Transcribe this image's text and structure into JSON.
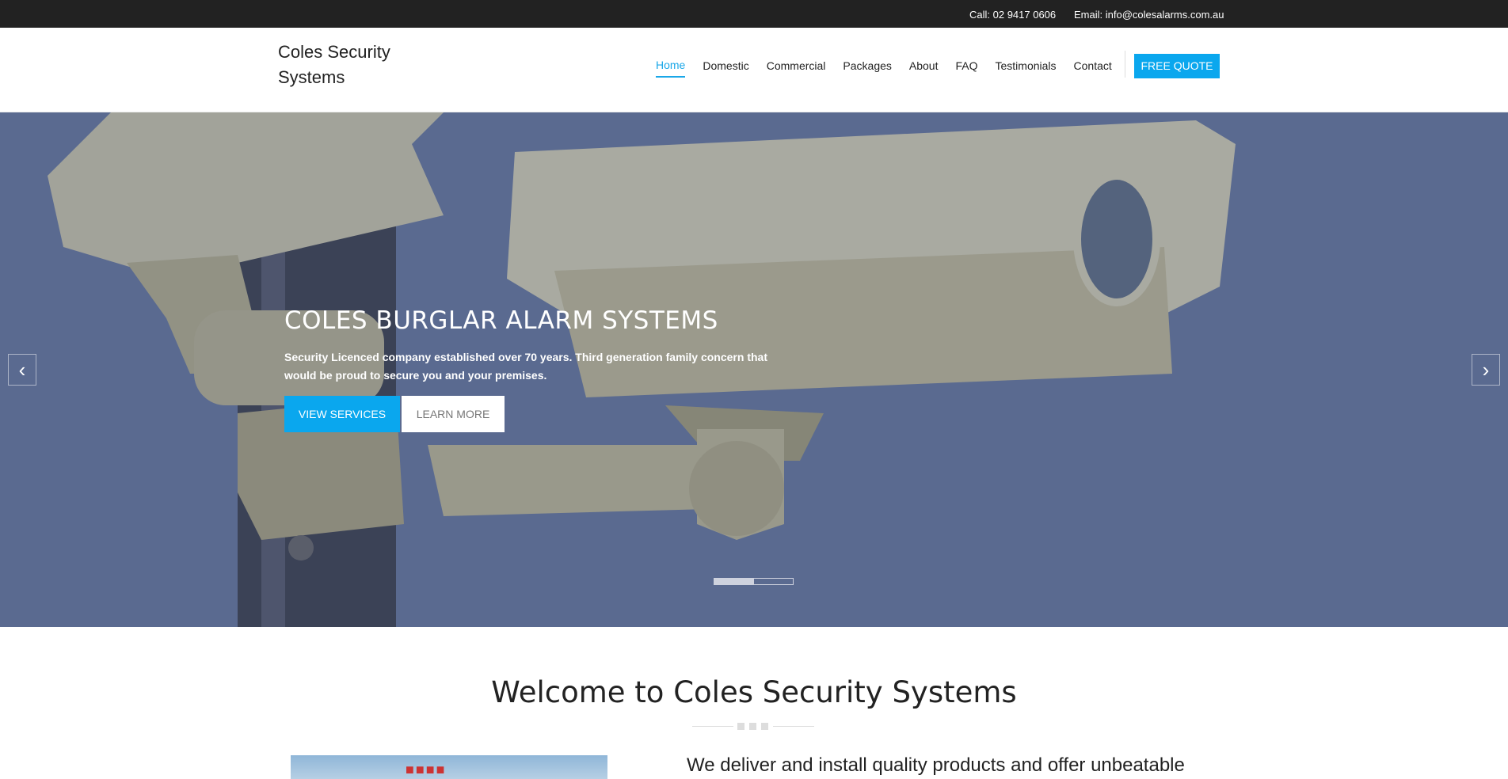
{
  "topbar": {
    "phone": "Call: 02 9417 0606",
    "email": "Email: info@colesalarms.com.au"
  },
  "header": {
    "logo": "Coles Security Systems",
    "nav": [
      "Home",
      "Domestic",
      "Commercial",
      "Packages",
      "About",
      "FAQ",
      "Testimonials",
      "Contact"
    ],
    "active_nav": "Home",
    "quote_button": "FREE QUOTE"
  },
  "hero": {
    "title": "COLES BURGLAR ALARM SYSTEMS",
    "text": "Security Licenced company established over 70 years. Third generation family concern that would be proud to secure you and your premises.",
    "primary_button": "VIEW SERVICES",
    "secondary_button": "LEARN MORE",
    "prev_icon": "chevron-left-icon",
    "next_icon": "chevron-right-icon",
    "slider_progress": 0.5
  },
  "welcome": {
    "title": "Welcome to Coles Security Systems",
    "subtitle": "We deliver and install quality products and offer unbeatable"
  },
  "colors": {
    "accent": "#0aa7ee",
    "topbar": "#222222",
    "hero_overlay": "#6b7a99"
  }
}
